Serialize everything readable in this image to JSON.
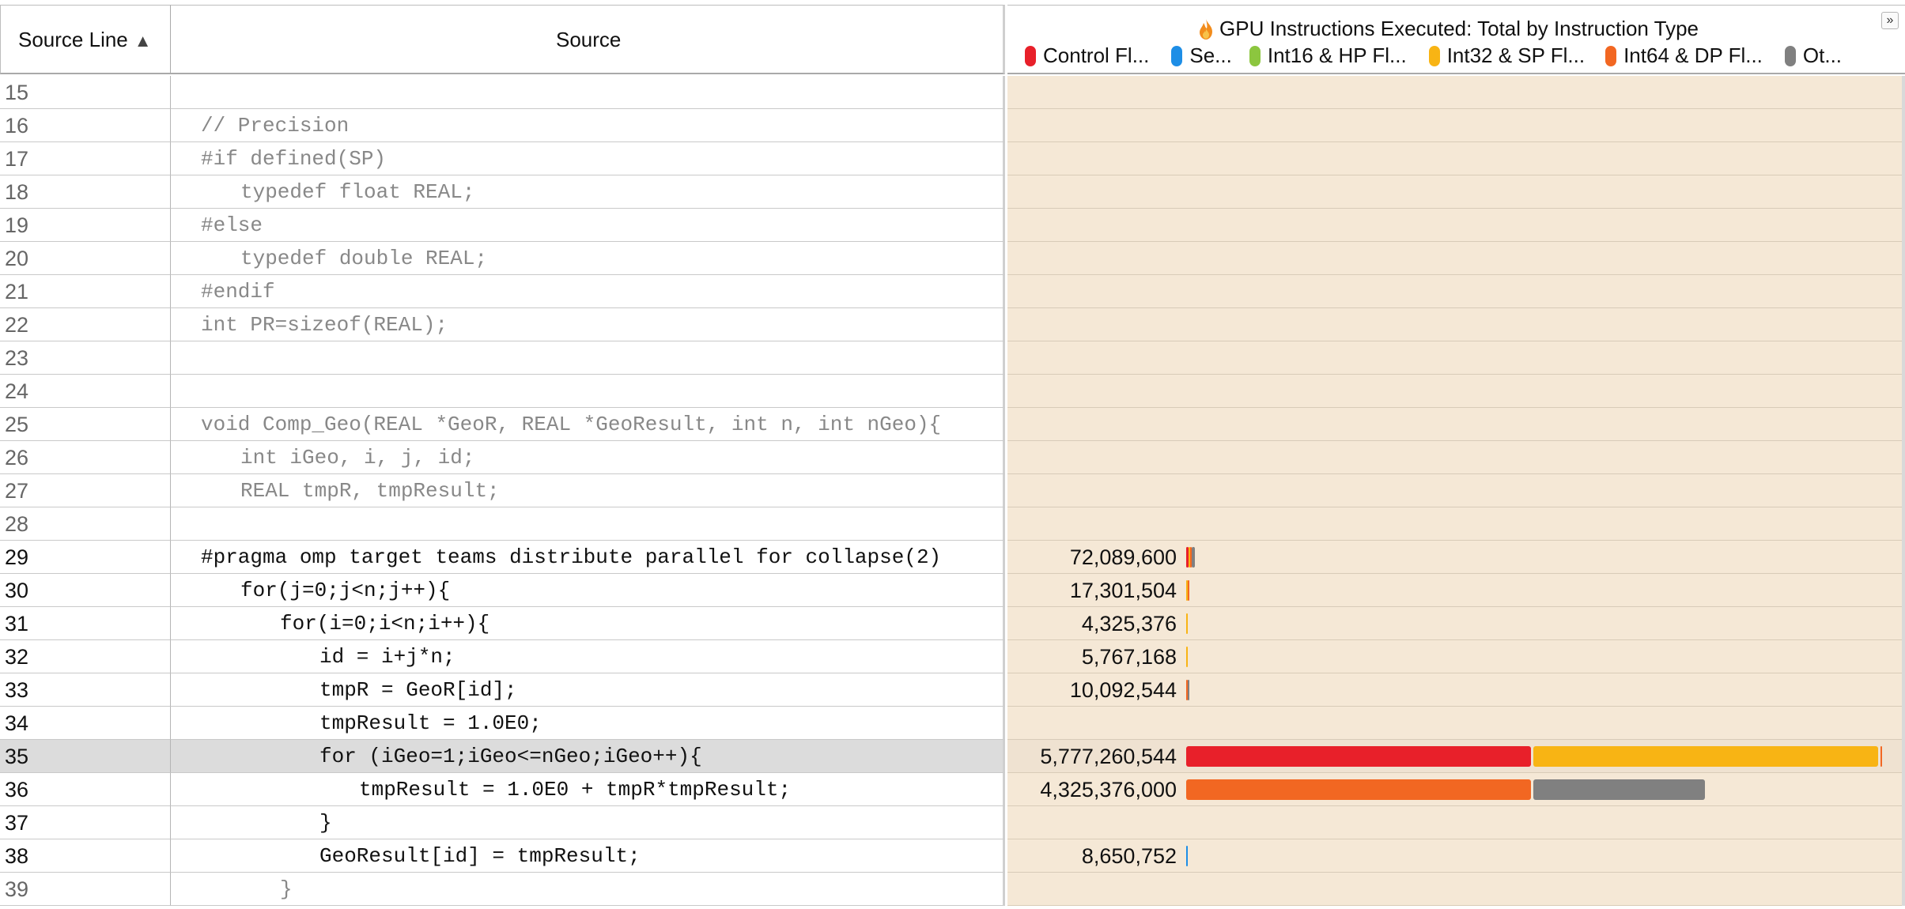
{
  "header": {
    "source_line_label": "Source Line",
    "sort_indicator": "▲",
    "source_label": "Source",
    "gpu_title": "GPU Instructions Executed: Total by Instruction Type",
    "collapse_glyph": "»",
    "flame_icon": "flame-icon"
  },
  "legend": [
    {
      "label": "Control Fl...",
      "color": "#e8202a"
    },
    {
      "label": "Se...",
      "color": "#1e8ee6"
    },
    {
      "label": "Int16 & HP Fl...",
      "color": "#8cc63f"
    },
    {
      "label": "Int32 & SP Fl...",
      "color": "#f8b414"
    },
    {
      "label": "Int64 & DP Fl...",
      "color": "#f26722"
    },
    {
      "label": "Ot...",
      "color": "#808080"
    }
  ],
  "colors": {
    "control": "#e8202a",
    "sel": "#1e8ee6",
    "int16": "#8cc63f",
    "int32": "#f8b414",
    "int64": "#f26722",
    "other": "#808080",
    "gpu_background": "#f5e8d6"
  },
  "rows": [
    {
      "line": "15",
      "code": "",
      "indent": 0,
      "active": false,
      "value": ""
    },
    {
      "line": "16",
      "code": "// Precision",
      "indent": 0,
      "active": false,
      "value": ""
    },
    {
      "line": "17",
      "code": "#if defined(SP)",
      "indent": 0,
      "active": false,
      "value": ""
    },
    {
      "line": "18",
      "code": "typedef float REAL;",
      "indent": 1,
      "active": false,
      "value": ""
    },
    {
      "line": "19",
      "code": "#else",
      "indent": 0,
      "active": false,
      "value": ""
    },
    {
      "line": "20",
      "code": "typedef double REAL;",
      "indent": 1,
      "active": false,
      "value": ""
    },
    {
      "line": "21",
      "code": "#endif",
      "indent": 0,
      "active": false,
      "value": ""
    },
    {
      "line": "22",
      "code": "int PR=sizeof(REAL);",
      "indent": 0,
      "active": false,
      "value": ""
    },
    {
      "line": "23",
      "code": "",
      "indent": 0,
      "active": false,
      "value": ""
    },
    {
      "line": "24",
      "code": "",
      "indent": 0,
      "active": false,
      "value": ""
    },
    {
      "line": "25",
      "code": "void Comp_Geo(REAL *GeoR, REAL *GeoResult, int n, int nGeo){",
      "indent": 0,
      "active": false,
      "value": ""
    },
    {
      "line": "26",
      "code": "int iGeo, i, j, id;",
      "indent": 1,
      "active": false,
      "value": ""
    },
    {
      "line": "27",
      "code": "REAL tmpR, tmpResult;",
      "indent": 1,
      "active": false,
      "value": ""
    },
    {
      "line": "28",
      "code": "",
      "indent": 0,
      "active": false,
      "value": ""
    },
    {
      "line": "29",
      "code": "#pragma omp target teams distribute parallel for collapse(2)",
      "indent": 0,
      "active": true,
      "value": "72,089,600",
      "segments": [
        {
          "type": "control",
          "count": 21000000
        },
        {
          "type": "int32",
          "count": 14000000
        },
        {
          "type": "int64",
          "count": 14000000
        },
        {
          "type": "other",
          "count": 23089600
        }
      ]
    },
    {
      "line": "30",
      "code": "for(j=0;j<n;j++){",
      "indent": 1,
      "active": true,
      "value": "17,301,504",
      "segments": [
        {
          "type": "int32",
          "count": 12000000
        },
        {
          "type": "int64",
          "count": 5301504
        }
      ]
    },
    {
      "line": "31",
      "code": "for(i=0;i<n;i++){",
      "indent": 2,
      "active": true,
      "value": "4,325,376",
      "segments": [
        {
          "type": "int32",
          "count": 4325376
        }
      ]
    },
    {
      "line": "32",
      "code": "id = i+j*n;",
      "indent": 3,
      "active": true,
      "value": "5,767,168",
      "segments": [
        {
          "type": "int32",
          "count": 5767168
        }
      ]
    },
    {
      "line": "33",
      "code": "tmpR = GeoR[id];",
      "indent": 3,
      "active": true,
      "value": "10,092,544",
      "segments": [
        {
          "type": "int64",
          "count": 5767168
        },
        {
          "type": "other",
          "count": 4325376
        }
      ]
    },
    {
      "line": "34",
      "code": "tmpResult = 1.0E0;",
      "indent": 3,
      "active": true,
      "value": ""
    },
    {
      "line": "35",
      "code": "for (iGeo=1;iGeo<=nGeo;iGeo++){",
      "indent": 3,
      "active": true,
      "selected": true,
      "value": "5,777,260,544",
      "segments": [
        {
          "type": "control",
          "count": 2883584000
        },
        {
          "type": "int32",
          "count": 2883584000
        },
        {
          "type": "int64",
          "count": 10092544
        }
      ]
    },
    {
      "line": "36",
      "code": "tmpResult = 1.0E0 + tmpR*tmpResult;",
      "indent": 4,
      "active": true,
      "value": "4,325,376,000",
      "segments": [
        {
          "type": "int64",
          "count": 2883584000
        },
        {
          "type": "other",
          "count": 1441792000
        }
      ]
    },
    {
      "line": "37",
      "code": "}",
      "indent": 3,
      "active": true,
      "value": ""
    },
    {
      "line": "38",
      "code": "GeoResult[id] = tmpResult;",
      "indent": 3,
      "active": true,
      "value": "8,650,752",
      "segments": [
        {
          "type": "sel",
          "count": 8650752
        }
      ]
    },
    {
      "line": "39",
      "code": "}",
      "indent": 2,
      "active": false,
      "value": ""
    }
  ],
  "bar_scale_max": 5777260544
}
